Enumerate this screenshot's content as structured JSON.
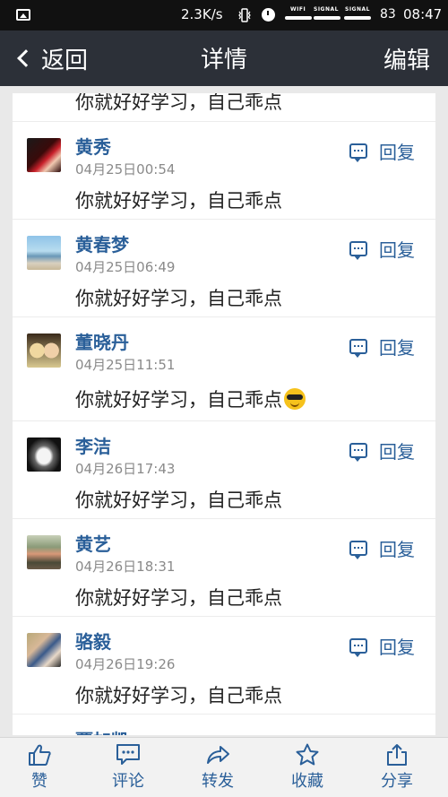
{
  "status_bar": {
    "net_speed": "2.3K/s",
    "wifi_label": "WIFI",
    "signal1_label": "SIGNAL",
    "signal2_label": "SIGNAL",
    "battery": "83",
    "time": "08:47"
  },
  "nav": {
    "back_label": "返回",
    "title": "详情",
    "edit_label": "编辑"
  },
  "list": {
    "partial_top_text": "你就好好学习，自己乖点",
    "items": [
      {
        "name": "黄秀",
        "time": "04月25日00:54",
        "content": "你就好好学习，自己乖点",
        "reply": "回复"
      },
      {
        "name": "黄春梦",
        "time": "04月25日06:49",
        "content": "你就好好学习，自己乖点",
        "reply": "回复"
      },
      {
        "name": "董晓丹",
        "time": "04月25日11:51",
        "content": "你就好好学习，自己乖点",
        "reply": "回复",
        "emoji": "sunglasses-emoji"
      },
      {
        "name": "李洁",
        "time": "04月26日17:43",
        "content": "你就好好学习，自己乖点",
        "reply": "回复"
      },
      {
        "name": "黄艺",
        "time": "04月26日18:31",
        "content": "你就好好学习，自己乖点",
        "reply": "回复"
      },
      {
        "name": "骆毅",
        "time": "04月26日19:26",
        "content": "你就好好学习，自己乖点",
        "reply": "回复"
      }
    ],
    "partial_bottom_name": "覃加凯"
  },
  "toolbar": {
    "like": "赞",
    "comment": "评论",
    "forward": "转发",
    "favorite": "收藏",
    "share": "分享"
  },
  "colors": {
    "accent": "#2a5f99",
    "nav_bg": "#2c3038",
    "status_bg": "#111111"
  },
  "icons": [
    "image-icon",
    "vibrate-icon",
    "alarm-icon",
    "back-chevron-icon",
    "reply-icon",
    "thumbs-up-icon",
    "comment-icon",
    "forward-icon",
    "star-icon",
    "share-icon"
  ]
}
